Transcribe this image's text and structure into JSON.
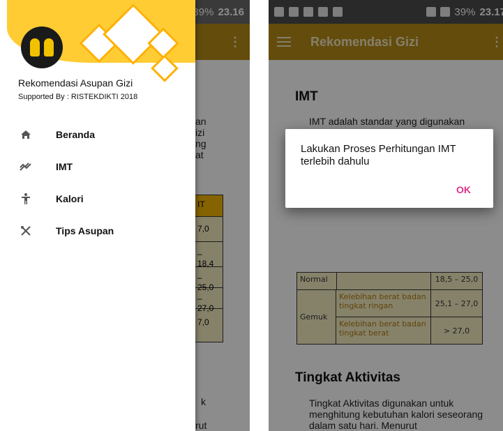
{
  "left": {
    "status": {
      "battery": "39%",
      "time": "23.16"
    },
    "appbar": {
      "menu": "⋮"
    },
    "behind_text": {
      "para": [
        "an",
        "izi",
        "ng",
        "at"
      ],
      "table_header": "IT",
      "values": [
        "7,0",
        "– 18,4",
        "– 25,0",
        "– 27,0",
        "7,0"
      ],
      "bottom": [
        "k",
        "rut"
      ]
    },
    "drawer": {
      "title": "Rekomendasi Asupan Gizi",
      "subtitle": "Supported By : RISTEKDIKTI 2018",
      "items": [
        {
          "label": "Beranda",
          "icon": "home-icon"
        },
        {
          "label": "IMT",
          "icon": "trend-icon"
        },
        {
          "label": "Kalori",
          "icon": "person-icon"
        },
        {
          "label": "Tips Asupan",
          "icon": "utensils-icon"
        }
      ]
    }
  },
  "right": {
    "status": {
      "battery": "39%",
      "time": "23.17"
    },
    "appbar": {
      "title": "Rekomendasi Gizi",
      "menu": "⋮"
    },
    "imt": {
      "heading": "IMT",
      "text": "IMT adalah standar yang digunakan untuk memantau tingkat status gizi seseorang. Batas ambang IMT yang berolaku di Indonesia, dapat dilihat pada tabel berikut :"
    },
    "table": {
      "normal_label": "Normal",
      "normal_value": "18,5 – 25,0",
      "gemuk_label": "Gemuk",
      "row1_desc": "Kelebihan berat badan tingkat ringan",
      "row1_value": "25,1 – 27,0",
      "row2_desc": "Kelebihan berat badan tingkat berat",
      "row2_value": "> 27,0"
    },
    "aktivitas": {
      "heading": "Tingkat Aktivitas",
      "text": "Tingkat Aktivitas digunakan untuk menghitung kebutuhan kalori seseorang dalam satu hari. Menurut"
    },
    "dialog": {
      "message": "Lakukan Proses Perhitungan IMT terlebih dahulu",
      "ok": "OK"
    }
  }
}
